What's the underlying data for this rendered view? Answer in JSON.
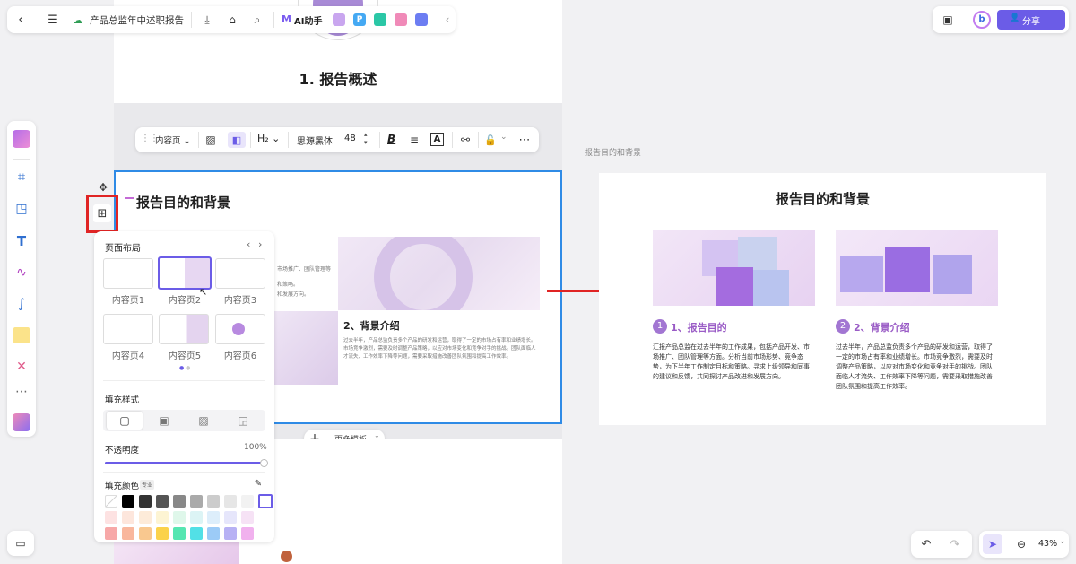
{
  "topbar": {
    "doc_title": "产品总监年中述职报告",
    "ai_label": "AI助手",
    "share_label": "分享"
  },
  "floating_toolbar": {
    "page_type": "内容页",
    "heading": "H₂",
    "font_name": "思源黑体",
    "font_size": "48",
    "bold": "B",
    "text_a": "A"
  },
  "slides": {
    "overview_title": "1. 报告概述",
    "main_title": "报告目的和背景",
    "section2_title": "2、背景介绍",
    "section2_body": "过去半年，产品总监负责多个产品的研发和运营，取得了一定的市场占有率和业绩增长。市场竞争激烈，需要及时调整产品策略，以应对市场变化和竞争对手的挑战。团队面临人才流失、工作效率下降等问题，需要采取措施改善团队氛围和提高工作效率。",
    "partial_left_text": "市场推广、团队管理等",
    "partial_left_text2": "和策略。",
    "partial_left_text3": "和发展方向。"
  },
  "layout_panel": {
    "title": "页面布局",
    "layouts": [
      "内容页1",
      "内容页2",
      "内容页3",
      "内容页4",
      "内容页5",
      "内容页6"
    ],
    "fill_style_label": "填充样式",
    "opacity_label": "不透明度",
    "opacity_value": "100%",
    "opacity_fraction": 1.0,
    "fill_color_label": "填充颜色",
    "pro_badge": "专业",
    "colors_row1": [
      "#000000",
      "#333333",
      "#555555",
      "#888888",
      "#aaaaaa",
      "#cccccc",
      "#e6e6e6",
      "#f2f2f2",
      "#ffffff"
    ],
    "colors_row2": [
      "#fde2e2",
      "#fde6dc",
      "#fdebd9",
      "#fdf4d3",
      "#dff7ea",
      "#dcf4f5",
      "#ddeefb",
      "#e6e6fb",
      "#f6e2f5"
    ],
    "colors_row3": [
      "#f7a8a8",
      "#f9b79d",
      "#f9c88f",
      "#fbd24a",
      "#55e6b1",
      "#52e0e6",
      "#9ccbf7",
      "#b7b1f4",
      "#f1b1ee"
    ]
  },
  "more_templates": "更多模板",
  "preview": {
    "caption": "报告目的和背景",
    "title": "报告目的和背景",
    "col1_num": "1",
    "col1_title": "1、报告目的",
    "col1_body": "汇报产品总监在过去半年的工作成果，包括产品开发、市场推广、团队管理等方面。分析当前市场形势、竞争态势，为下半年工作制定目标和策略。寻求上级领导和同事的建议和反馈，共同探讨产品改进和发展方向。",
    "col2_num": "2",
    "col2_title": "2、背景介绍",
    "col2_body": "过去半年，产品总监负责多个产品的研发和运营，取得了一定的市场占有率和业绩增长。市场竞争激烈，需要及时调整产品策略，以应对市场变化和竞争对手的挑战。团队面临人才流失、工作效率下降等问题，需要采取措施改善团队氛围和提高工作效率。"
  },
  "zoom": "43%",
  "colors": {
    "accent": "#6b5ce7",
    "highlight_red": "#e02424",
    "selection_blue": "#2f8be6",
    "heading_purple": "#9a5cc6"
  }
}
